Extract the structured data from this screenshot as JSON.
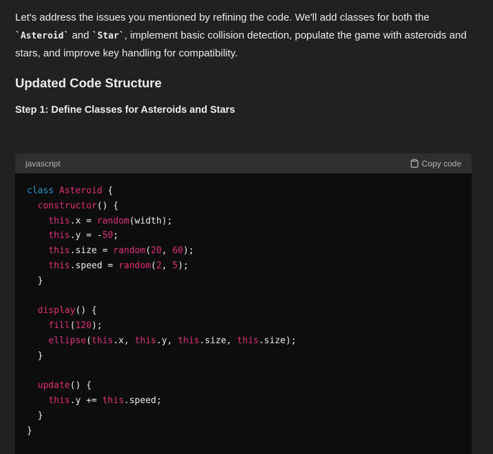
{
  "intro": {
    "part1": "Let's address the issues you mentioned by refining the code. We'll add classes for both the ",
    "code1": "`Asteroid`",
    "part2": " and ",
    "code2": "`Star`",
    "part3": ", implement basic collision detection, populate the game with asteroids and stars, and improve key handling for compatibility."
  },
  "heading": "Updated Code Structure",
  "subheading": "Step 1: Define Classes for Asteroids and Stars",
  "code_block": {
    "language": "javascript",
    "copy_label": "Copy code",
    "lines": [
      [
        [
          "kw",
          "class"
        ],
        [
          "plain",
          " "
        ],
        [
          "cls",
          "Asteroid"
        ],
        [
          "plain",
          " {"
        ]
      ],
      [
        [
          "plain",
          "  "
        ],
        [
          "fn",
          "constructor"
        ],
        [
          "plain",
          "() {"
        ]
      ],
      [
        [
          "plain",
          "    "
        ],
        [
          "this",
          "this"
        ],
        [
          "plain",
          ".x = "
        ],
        [
          "fn",
          "random"
        ],
        [
          "plain",
          "(width);"
        ]
      ],
      [
        [
          "plain",
          "    "
        ],
        [
          "this",
          "this"
        ],
        [
          "plain",
          ".y = -"
        ],
        [
          "num",
          "50"
        ],
        [
          "plain",
          ";"
        ]
      ],
      [
        [
          "plain",
          "    "
        ],
        [
          "this",
          "this"
        ],
        [
          "plain",
          ".size = "
        ],
        [
          "fn",
          "random"
        ],
        [
          "plain",
          "("
        ],
        [
          "num",
          "20"
        ],
        [
          "plain",
          ", "
        ],
        [
          "num",
          "60"
        ],
        [
          "plain",
          ");"
        ]
      ],
      [
        [
          "plain",
          "    "
        ],
        [
          "this",
          "this"
        ],
        [
          "plain",
          ".speed = "
        ],
        [
          "fn",
          "random"
        ],
        [
          "plain",
          "("
        ],
        [
          "num",
          "2"
        ],
        [
          "plain",
          ", "
        ],
        [
          "num",
          "5"
        ],
        [
          "plain",
          ");"
        ]
      ],
      [
        [
          "plain",
          "  }"
        ]
      ],
      [
        [
          "plain",
          ""
        ]
      ],
      [
        [
          "plain",
          "  "
        ],
        [
          "fn",
          "display"
        ],
        [
          "plain",
          "() {"
        ]
      ],
      [
        [
          "plain",
          "    "
        ],
        [
          "fn",
          "fill"
        ],
        [
          "plain",
          "("
        ],
        [
          "num",
          "120"
        ],
        [
          "plain",
          ");"
        ]
      ],
      [
        [
          "plain",
          "    "
        ],
        [
          "fn",
          "ellipse"
        ],
        [
          "plain",
          "("
        ],
        [
          "this",
          "this"
        ],
        [
          "plain",
          ".x, "
        ],
        [
          "this",
          "this"
        ],
        [
          "plain",
          ".y, "
        ],
        [
          "this",
          "this"
        ],
        [
          "plain",
          ".size, "
        ],
        [
          "this",
          "this"
        ],
        [
          "plain",
          ".size);"
        ]
      ],
      [
        [
          "plain",
          "  }"
        ]
      ],
      [
        [
          "plain",
          ""
        ]
      ],
      [
        [
          "plain",
          "  "
        ],
        [
          "fn",
          "update"
        ],
        [
          "plain",
          "() {"
        ]
      ],
      [
        [
          "plain",
          "    "
        ],
        [
          "this",
          "this"
        ],
        [
          "plain",
          ".y += "
        ],
        [
          "this",
          "this"
        ],
        [
          "plain",
          ".speed;"
        ]
      ],
      [
        [
          "plain",
          "  }"
        ]
      ],
      [
        [
          "plain",
          "}"
        ]
      ]
    ]
  },
  "colors": {
    "background": "#212121",
    "code_background": "#0d0d0d",
    "code_header": "#2f2f2f",
    "keyword": "#2e95d3",
    "accent": "#df3079"
  },
  "icons": {
    "copy": "clipboard-icon"
  }
}
